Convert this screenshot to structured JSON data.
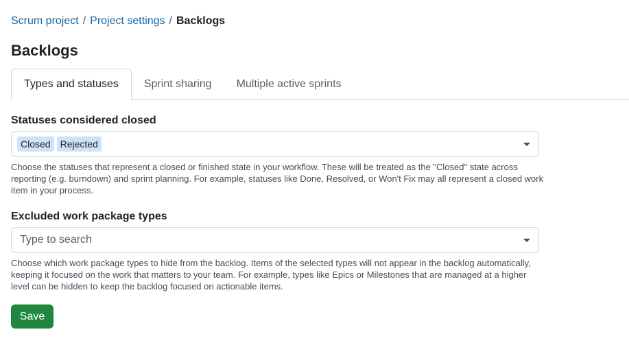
{
  "breadcrumb": {
    "project": "Scrum project",
    "settings": "Project settings",
    "current": "Backlogs",
    "separator": "/"
  },
  "page": {
    "title": "Backlogs"
  },
  "tabs": [
    {
      "label": "Types and statuses",
      "active": true
    },
    {
      "label": "Sprint sharing",
      "active": false
    },
    {
      "label": "Multiple active sprints",
      "active": false
    }
  ],
  "closed_statuses": {
    "label": "Statuses considered closed",
    "selected": [
      "Closed",
      "Rejected"
    ],
    "help": "Choose the statuses that represent a closed or finished state in your workflow. These will be treated as the \"Closed\" state across reporting (e.g. burndown) and sprint planning. For example, statuses like Done, Resolved, or Won't Fix may all represent a closed work item in your process."
  },
  "excluded_types": {
    "label": "Excluded work package types",
    "placeholder": "Type to search",
    "help": "Choose which work package types to hide from the backlog. Items of the selected types will not appear in the backlog automatically, keeping it focused on the work that matters to your team. For example, types like Epics or Milestones that are managed at a higher level can be hidden to keep the backlog focused on actionable items."
  },
  "actions": {
    "save_label": "Save"
  },
  "colors": {
    "link": "#1a67a3",
    "chip_background": "#cfe2f7",
    "primary_button": "#1f883d"
  },
  "icons": {
    "dropdown": "chevron-down-icon"
  }
}
